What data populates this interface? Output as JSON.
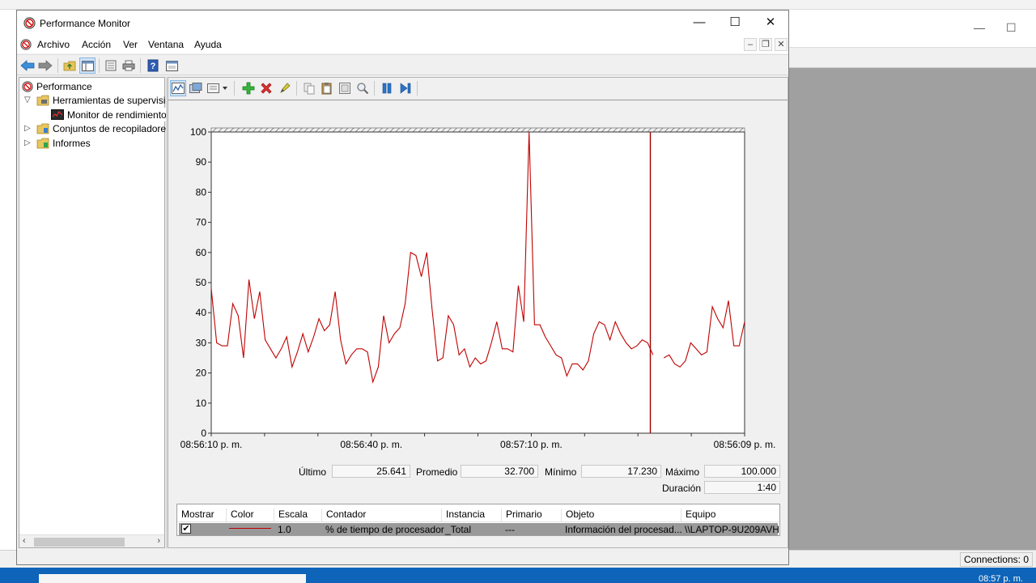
{
  "window": {
    "title": "Performance Monitor",
    "controls": {
      "minimize": "—",
      "maximize": "☐",
      "close": "✕"
    }
  },
  "menubar": {
    "items": [
      "Archivo",
      "Acción",
      "Ver",
      "Ventana",
      "Ayuda"
    ],
    "mdi_controls": {
      "minimize": "–",
      "restore": "❐",
      "close": "✕"
    }
  },
  "toolbar1": {
    "buttons": [
      "back-arrow-icon",
      "forward-arrow-icon",
      "folder-up-icon",
      "show-hide-tree-icon",
      "properties-icon",
      "print-icon",
      "help-icon",
      "console-icon"
    ]
  },
  "tree": {
    "items": [
      {
        "label": "Performance",
        "icon": "perfmon-icon",
        "level": 0
      },
      {
        "label": "Herramientas de supervisión",
        "icon": "folder-tools-icon",
        "level": 1,
        "expanded": true
      },
      {
        "label": "Monitor de rendimiento",
        "icon": "monitor-icon",
        "level": 2,
        "selected": true
      },
      {
        "label": "Conjuntos de recopiladores de datos",
        "icon": "folder-collector-icon",
        "level": 1,
        "expanded": false
      },
      {
        "label": "Informes",
        "icon": "folder-reports-icon",
        "level": 1,
        "expanded": false
      }
    ]
  },
  "toolbar2": {
    "buttons": [
      "view-graph-icon",
      "change-graph-type-icon",
      "dropdown-arrow-icon",
      "add-counter-icon",
      "delete-counter-icon",
      "highlight-icon",
      "copy-properties-icon",
      "paste-counter-list-icon",
      "properties-icon",
      "zoom-icon",
      "freeze-display-icon",
      "update-data-icon"
    ]
  },
  "chart_data": {
    "type": "line",
    "ylim": [
      0,
      100
    ],
    "yticks": [
      0,
      10,
      20,
      30,
      40,
      50,
      60,
      70,
      80,
      90,
      100
    ],
    "xtick_labels": [
      "08:56:10 p. m.",
      "08:56:40 p. m.",
      "08:57:10 p. m.",
      "08:56:09 p. m."
    ],
    "x_count": 100,
    "current_index": 81,
    "series": [
      {
        "color": "#c00000",
        "values": [
          48,
          30,
          29,
          29,
          43,
          39,
          25,
          51,
          38,
          47,
          31,
          28,
          25,
          28,
          32,
          22,
          27,
          33,
          27,
          32,
          38,
          34,
          36,
          47,
          31,
          23,
          26,
          28,
          28,
          27,
          17,
          22,
          39,
          30,
          33,
          35,
          43,
          60,
          59,
          52,
          60,
          41,
          24,
          25,
          39,
          36,
          26,
          28,
          22,
          25,
          23,
          24,
          30,
          37,
          28,
          28,
          27,
          49,
          37,
          100,
          36,
          36,
          32,
          29,
          26,
          25,
          19,
          23,
          23,
          21,
          24,
          33,
          37,
          36,
          31,
          37,
          33,
          30,
          28,
          29,
          31,
          30,
          26,
          null,
          25,
          26,
          23,
          22,
          24,
          30,
          28,
          26,
          27,
          42,
          38,
          35,
          44,
          29,
          29,
          37
        ]
      }
    ]
  },
  "stats": {
    "ultimo_label": "Último",
    "ultimo": "25.641",
    "promedio_label": "Promedio",
    "promedio": "32.700",
    "minimo_label": "Mínimo",
    "minimo": "17.230",
    "maximo_label": "Máximo",
    "maximo": "100.000",
    "duracion_label": "Duración",
    "duracion": "1:40"
  },
  "counter_table": {
    "headers": [
      "Mostrar",
      "Color",
      "Escala",
      "Contador",
      "Instancia",
      "Primario",
      "Objeto",
      "Equipo"
    ],
    "rows": [
      {
        "show": "✔",
        "color": "#c00000",
        "scale": "1.0",
        "counter": "% de tiempo de procesador",
        "instance": "_Total",
        "parent": "---",
        "object": "Información del procesad...",
        "computer": "\\\\LAPTOP-9U209AVH"
      }
    ]
  },
  "background": {
    "connections": "Connections: 0",
    "clock": "08:57 p. m."
  }
}
